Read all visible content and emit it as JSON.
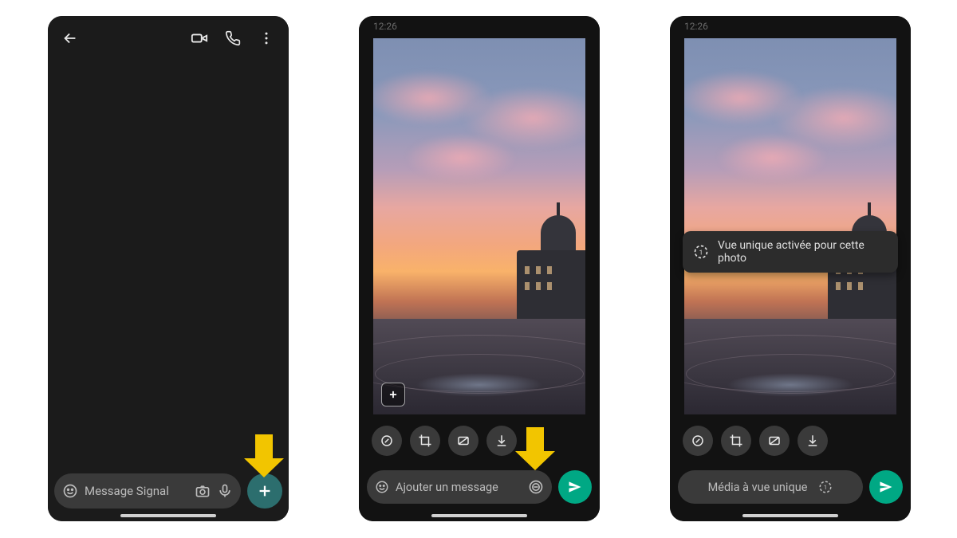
{
  "screen1": {
    "composer_placeholder": "Message Signal"
  },
  "screen2": {
    "status_time": "12:26",
    "caption_placeholder": "Ajouter un message"
  },
  "screen3": {
    "status_time": "12:26",
    "caption_label": "Média à vue unique",
    "toast_text": "Vue unique activée pour cette photo"
  },
  "colors": {
    "accent": "#00a884",
    "fab": "#2c6e6e",
    "callout": "#f2c500"
  }
}
